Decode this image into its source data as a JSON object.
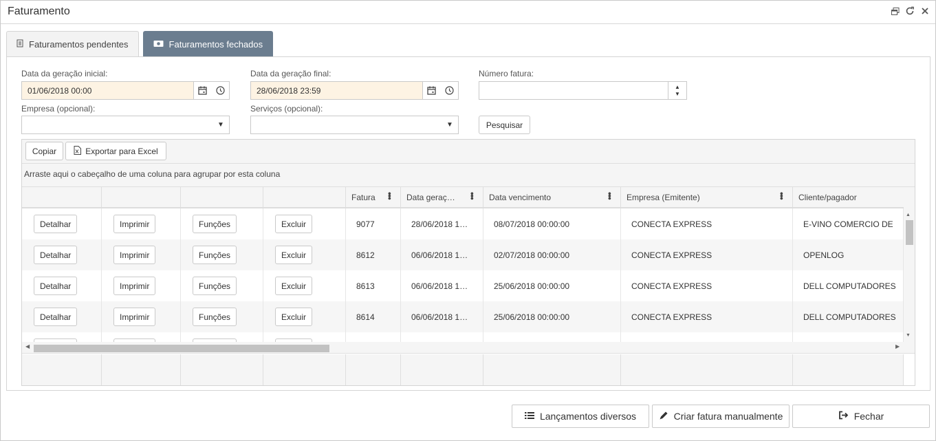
{
  "window": {
    "title": "Faturamento",
    "controls": [
      "restore-icon",
      "refresh-icon",
      "close-icon"
    ]
  },
  "tabs": [
    {
      "label": "Faturamentos pendentes",
      "icon": "document-icon",
      "active": false
    },
    {
      "label": "Faturamentos fechados",
      "icon": "money-icon",
      "active": true
    }
  ],
  "filters": {
    "start_label": "Data da geração inicial:",
    "start_value": "01/06/2018 00:00",
    "end_label": "Data da geração final:",
    "end_value": "28/06/2018 23:59",
    "invoice_label": "Número fatura:",
    "invoice_value": "",
    "company_label": "Empresa (opcional):",
    "company_value": "",
    "services_label": "Serviços (opcional):",
    "services_value": "",
    "search_button": "Pesquisar"
  },
  "grid": {
    "toolbar": {
      "copy": "Copiar",
      "export": "Exportar para Excel"
    },
    "group_hint": "Arraste aqui o cabeçalho de uma coluna para agrupar por esta coluna",
    "columns": [
      "Fatura",
      "Data geraç…",
      "Data vencimento",
      "Empresa (Emitente)",
      "Cliente/pagador"
    ],
    "action_buttons": [
      "Detalhar",
      "Imprimir",
      "Funções",
      "Excluir"
    ],
    "rows": [
      {
        "fatura": "9077",
        "geracao": "28/06/2018 1…",
        "vencimento": "08/07/2018 00:00:00",
        "empresa": "CONECTA EXPRESS",
        "cliente": "E-VINO COMERCIO DE"
      },
      {
        "fatura": "8612",
        "geracao": "06/06/2018 1…",
        "vencimento": "02/07/2018 00:00:00",
        "empresa": "CONECTA EXPRESS",
        "cliente": "OPENLOG"
      },
      {
        "fatura": "8613",
        "geracao": "06/06/2018 1…",
        "vencimento": "25/06/2018 00:00:00",
        "empresa": "CONECTA EXPRESS",
        "cliente": "DELL COMPUTADORES"
      },
      {
        "fatura": "8614",
        "geracao": "06/06/2018 1…",
        "vencimento": "25/06/2018 00:00:00",
        "empresa": "CONECTA EXPRESS",
        "cliente": "DELL COMPUTADORES"
      }
    ]
  },
  "footer": {
    "misc_button": "Lançamentos diversos",
    "manual_button": "Criar fatura manualmente",
    "close_button": "Fechar"
  }
}
